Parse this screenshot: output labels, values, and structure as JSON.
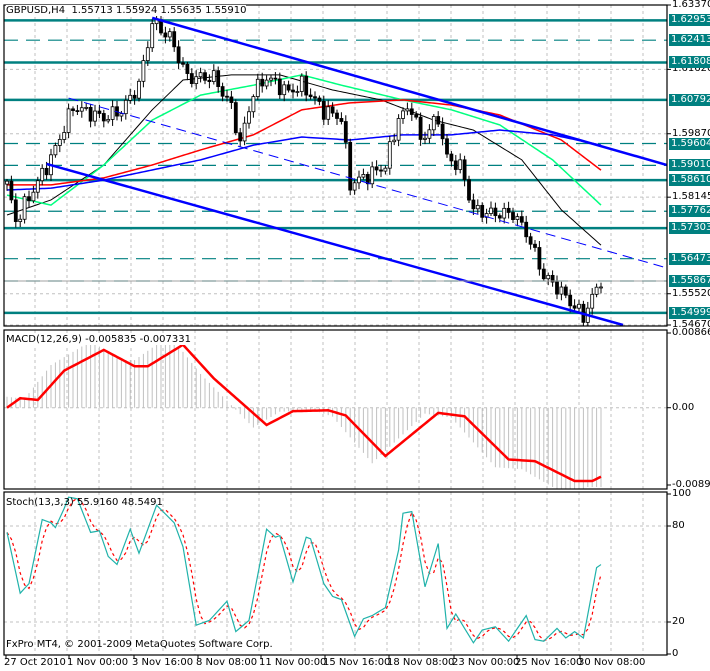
{
  "header": {
    "symbol": "GBPUSD,H4",
    "open": "1.55713",
    "high": "1.55924",
    "low": "1.55635",
    "close": "1.55910"
  },
  "copyright": "FxPro MT4, © 2001-2009 MetaQuotes Software Corp.",
  "colors": {
    "level": "#008080",
    "trend": "#0000ff",
    "ma_fast": "#000000",
    "ma_mid": "#00ff7f",
    "ma_slow": "#ff0000",
    "ma_long": "#0000ff",
    "macd_signal": "#ff0000",
    "macd_hist": "#c0c0c0",
    "stoch_main": "#20b2aa",
    "stoch_signal": "#ff0000",
    "grid": "#c0c0c0"
  },
  "chart_data": [
    {
      "type": "candlestick",
      "title": "GBPUSD,H4",
      "ylim": [
        1.5467,
        1.6337
      ],
      "axis_ticks": [
        "1.63370",
        "1.61620",
        "1.59870",
        "1.58145",
        "1.55520",
        "1.54670"
      ],
      "x_ticks": [
        "27 Oct 2010",
        "1 Nov 00:00",
        "3 Nov 16:00",
        "8 Nov 08:00",
        "11 Nov 00:00",
        "15 Nov 16:00",
        "18 Nov 08:00",
        "23 Nov 00:00",
        "25 Nov 16:00",
        "30 Nov 08:00"
      ],
      "bars": 136,
      "close_path": [
        [
          0,
          1.585
        ],
        [
          2,
          1.575
        ],
        [
          10,
          1.592
        ],
        [
          15,
          1.606
        ],
        [
          22,
          1.603
        ],
        [
          26,
          1.605
        ],
        [
          30,
          1.612
        ],
        [
          33,
          1.629
        ],
        [
          37,
          1.625
        ],
        [
          41,
          1.614
        ],
        [
          47,
          1.614
        ],
        [
          51,
          1.606
        ],
        [
          53,
          1.596
        ],
        [
          56,
          1.61
        ],
        [
          59,
          1.614
        ],
        [
          64,
          1.61
        ],
        [
          67,
          1.612
        ],
        [
          72,
          1.605
        ],
        [
          76,
          1.603
        ],
        [
          78,
          1.585
        ],
        [
          83,
          1.588
        ],
        [
          86,
          1.59
        ],
        [
          89,
          1.603
        ],
        [
          92,
          1.606
        ],
        [
          94,
          1.597
        ],
        [
          98,
          1.603
        ],
        [
          100,
          1.592
        ],
        [
          103,
          1.59
        ],
        [
          106,
          1.578
        ],
        [
          110,
          1.577
        ],
        [
          115,
          1.577
        ],
        [
          118,
          1.572
        ],
        [
          122,
          1.56
        ],
        [
          125,
          1.557
        ],
        [
          128,
          1.553
        ],
        [
          131,
          1.549
        ],
        [
          135,
          1.5591
        ]
      ],
      "levels": [
        {
          "price": "1.62953",
          "style": "solid"
        },
        {
          "price": "1.62413",
          "style": "dashed"
        },
        {
          "price": "1.61808",
          "style": "solid"
        },
        {
          "price": "1.60792",
          "style": "solid"
        },
        {
          "price": "1.59604",
          "style": "dashed"
        },
        {
          "price": "1.59010",
          "style": "dashed"
        },
        {
          "price": "1.58610",
          "style": "solid"
        },
        {
          "price": "1.57762",
          "style": "dashed"
        },
        {
          "price": "1.57303",
          "style": "solid"
        },
        {
          "price": "1.56473",
          "style": "dashed"
        },
        {
          "price": "1.55867",
          "style": "dashed"
        },
        {
          "price": "1.54999",
          "style": "solid"
        }
      ],
      "trendlines": [
        {
          "name": "channel-top",
          "points": [
            [
              33,
              1.6302
            ],
            [
              150,
              1.5902
            ]
          ],
          "style": "solid"
        },
        {
          "name": "channel-bottom",
          "points": [
            [
              9,
              1.5905
            ],
            [
              140,
              1.5467
            ]
          ],
          "style": "solid"
        },
        {
          "name": "channel-mid",
          "points": [
            [
              14,
              1.6084
            ],
            [
              150,
              1.5622
            ]
          ],
          "style": "dashed"
        }
      ],
      "moving_averages": [
        {
          "name": "ma-fast",
          "color_key": "ma_fast",
          "points": [
            [
              0,
              1.5766
            ],
            [
              10,
              1.5807
            ],
            [
              22,
              1.5902
            ],
            [
              33,
              1.6052
            ],
            [
              40,
              1.6133
            ],
            [
              51,
              1.6147
            ],
            [
              62,
              1.6147
            ],
            [
              74,
              1.6106
            ],
            [
              85,
              1.6079
            ],
            [
              97,
              1.6024
            ],
            [
              106,
              1.5997
            ],
            [
              117,
              1.5916
            ],
            [
              126,
              1.578
            ],
            [
              135,
              1.5684
            ]
          ]
        },
        {
          "name": "ma-mid",
          "color_key": "ma_mid",
          "points": [
            [
              0,
              1.582
            ],
            [
              10,
              1.5793
            ],
            [
              22,
              1.5902
            ],
            [
              33,
              1.6024
            ],
            [
              44,
              1.6092
            ],
            [
              56,
              1.6119
            ],
            [
              67,
              1.6147
            ],
            [
              76,
              1.6119
            ],
            [
              90,
              1.6079
            ],
            [
              101,
              1.6052
            ],
            [
              112,
              1.6011
            ],
            [
              124,
              1.5916
            ],
            [
              135,
              1.5793
            ]
          ]
        },
        {
          "name": "ma-slow",
          "color_key": "ma_slow",
          "points": [
            [
              0,
              1.5848
            ],
            [
              10,
              1.5848
            ],
            [
              22,
              1.5867
            ],
            [
              33,
              1.5902
            ],
            [
              44,
              1.5943
            ],
            [
              56,
              1.5984
            ],
            [
              67,
              1.6052
            ],
            [
              78,
              1.6071
            ],
            [
              90,
              1.6079
            ],
            [
              101,
              1.6065
            ],
            [
              112,
              1.6038
            ],
            [
              126,
              1.597
            ],
            [
              135,
              1.5888
            ]
          ]
        },
        {
          "name": "ma-long",
          "color_key": "ma_long",
          "points": [
            [
              0,
              1.5834
            ],
            [
              10,
              1.5839
            ],
            [
              22,
              1.5861
            ],
            [
              44,
              1.5916
            ],
            [
              56,
              1.5956
            ],
            [
              67,
              1.5978
            ],
            [
              78,
              1.597
            ],
            [
              90,
              1.5984
            ],
            [
              101,
              1.5984
            ],
            [
              112,
              1.5997
            ],
            [
              124,
              1.5984
            ],
            [
              135,
              1.5956
            ]
          ]
        }
      ]
    },
    {
      "type": "line",
      "title": "MACD(12,26,9) -0.005835 -0.007331",
      "ylim": [
        -0.00896,
        0.00866
      ],
      "axis_ticks": [
        "0.00866",
        "0.00",
        "-0.00896"
      ],
      "signal": [
        [
          0,
          0.0
        ],
        [
          3,
          0.0011
        ],
        [
          7,
          0.0009
        ],
        [
          13,
          0.0043
        ],
        [
          22,
          0.0067
        ],
        [
          29,
          0.0048
        ],
        [
          32,
          0.0048
        ],
        [
          40,
          0.0073
        ],
        [
          47,
          0.0034
        ],
        [
          59,
          -0.002
        ],
        [
          65,
          -0.0004
        ],
        [
          73,
          -0.0003
        ],
        [
          77,
          -0.0009
        ],
        [
          86,
          -0.0056
        ],
        [
          98,
          -0.0006
        ],
        [
          104,
          -0.001
        ],
        [
          114,
          -0.006
        ],
        [
          120,
          -0.0062
        ],
        [
          129,
          -0.0085
        ],
        [
          133,
          -0.0085
        ],
        [
          135,
          -0.008
        ]
      ]
    },
    {
      "type": "line",
      "title": "Stoch(13,3,3) 55.9160 48.5491",
      "ylim": [
        0,
        100
      ],
      "axis_ticks": [
        "100",
        "80",
        "20",
        "0"
      ],
      "main": [
        [
          0,
          76
        ],
        [
          3,
          38
        ],
        [
          5,
          44
        ],
        [
          8,
          84
        ],
        [
          10,
          82
        ],
        [
          11,
          79
        ],
        [
          13,
          91
        ],
        [
          14,
          98
        ],
        [
          16,
          97
        ],
        [
          19,
          76
        ],
        [
          21,
          77
        ],
        [
          23,
          61
        ],
        [
          25,
          56
        ],
        [
          28,
          78
        ],
        [
          30,
          63
        ],
        [
          34,
          93
        ],
        [
          38,
          82
        ],
        [
          40,
          67
        ],
        [
          43,
          18
        ],
        [
          46,
          21
        ],
        [
          50,
          33
        ],
        [
          52,
          14
        ],
        [
          55,
          21
        ],
        [
          59,
          78
        ],
        [
          61,
          73
        ],
        [
          62,
          74
        ],
        [
          65,
          45
        ],
        [
          68,
          73
        ],
        [
          69,
          72
        ],
        [
          72,
          44
        ],
        [
          74,
          36
        ],
        [
          76,
          34
        ],
        [
          79,
          11
        ],
        [
          81,
          22
        ],
        [
          83,
          24
        ],
        [
          86,
          29
        ],
        [
          89,
          65
        ],
        [
          90,
          88
        ],
        [
          92,
          89
        ],
        [
          95,
          42
        ],
        [
          98,
          69
        ],
        [
          100,
          16
        ],
        [
          102,
          25
        ],
        [
          106,
          7
        ],
        [
          108,
          15
        ],
        [
          111,
          17
        ],
        [
          114,
          8
        ],
        [
          118,
          24
        ],
        [
          120,
          9
        ],
        [
          122,
          8
        ],
        [
          125,
          16
        ],
        [
          127,
          10
        ],
        [
          129,
          14
        ],
        [
          131,
          10
        ],
        [
          134,
          54
        ],
        [
          135,
          55.9
        ]
      ]
    }
  ]
}
